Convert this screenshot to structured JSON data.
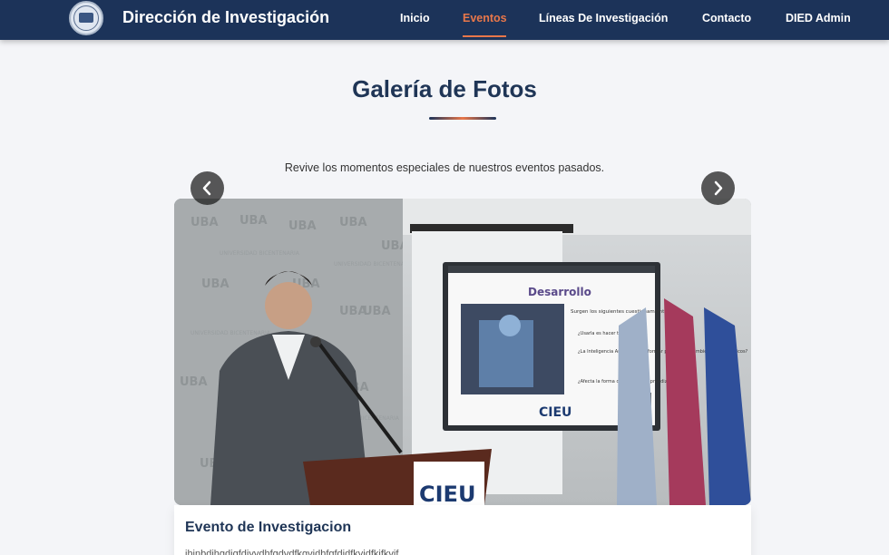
{
  "header": {
    "brand": "Dirección de Investigación",
    "logo_icon": "university-seal-icon",
    "nav": [
      {
        "label": "Inicio",
        "active": false
      },
      {
        "label": "Eventos",
        "active": true
      },
      {
        "label": "Líneas De Investigación",
        "active": false
      },
      {
        "label": "Contacto",
        "active": false
      },
      {
        "label": "DIED Admin",
        "active": false
      }
    ]
  },
  "gallery": {
    "title": "Galería de Fotos",
    "subtitle": "Revive los momentos especiales de nuestros eventos pasados.",
    "prev_icon": "chevron-left-icon",
    "next_icon": "chevron-right-icon",
    "photo": {
      "banner_text": "UBA",
      "banner_subtext": "UNIVERSIDAD BICENTENARIA",
      "slide_title": "Desarrollo",
      "slide_heading": "Surgen los siguientes cuestionamientos:",
      "slide_bullets": [
        "¿Usarla es hacer trampa?",
        "¿La Inteligencia Artificial debe formar parte de los ambientes académicos?",
        "¿Afecta la forma de evaluar el aprendizaje?"
      ],
      "slide_logo": "CIEU",
      "podium_text": "CIEU"
    }
  },
  "caption": {
    "title": "Evento de Investigacion",
    "text": "ihjnbdihgdigfdiyvdhfgdvdfkgvjdhfgfdjdfkvjdfkjfkvjf"
  },
  "colors": {
    "navbar": "#1c3359",
    "accent": "#e8774a",
    "title": "#1f3556",
    "background": "#f4f5f8"
  }
}
